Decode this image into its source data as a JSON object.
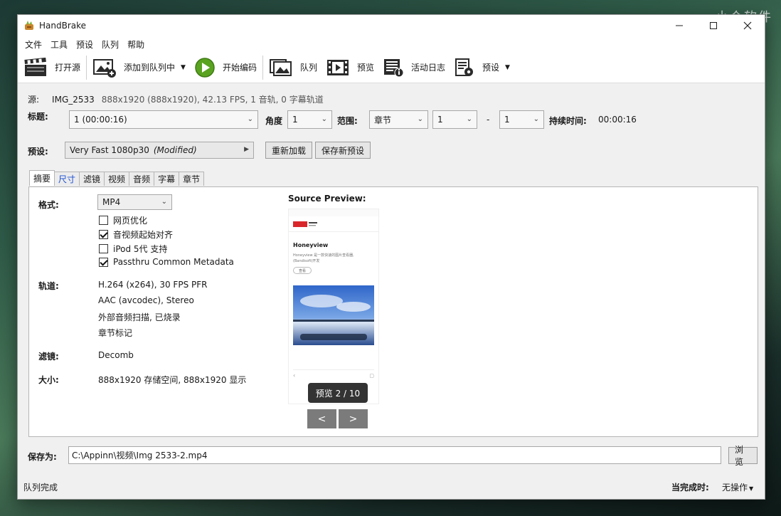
{
  "watermark": "小众软件",
  "window": {
    "title": "HandBrake"
  },
  "menu": [
    "文件",
    "工具",
    "预设",
    "队列",
    "帮助"
  ],
  "toolbar": {
    "open_source": "打开源",
    "add_to_queue": "添加到队列中",
    "start_encode": "开始编码",
    "queue": "队列",
    "preview": "预览",
    "activity_log": "活动日志",
    "presets": "预设"
  },
  "source": {
    "label": "源:",
    "name": "IMG_2533",
    "info": "888x1920 (888x1920), 42.13 FPS, 1 音轨, 0 字幕轨道"
  },
  "title_row": {
    "title_label": "标题:",
    "title_value": "1  (00:00:16)",
    "angle_label": "角度",
    "angle_value": "1",
    "range_label": "范围:",
    "range_type": "章节",
    "range_start": "1",
    "range_dash": "-",
    "range_end": "1",
    "duration_label": "持续时间:",
    "duration_value": "00:00:16"
  },
  "preset_row": {
    "label": "预设:",
    "value": "Very Fast 1080p30",
    "modified": "(Modified)",
    "reload": "重新加载",
    "save_new": "保存新预设"
  },
  "tabs": [
    "摘要",
    "尺寸",
    "滤镜",
    "视频",
    "音频",
    "字幕",
    "章节"
  ],
  "summary": {
    "format_label": "格式:",
    "format_value": "MP4",
    "options": [
      {
        "label": "网页优化",
        "checked": false
      },
      {
        "label": "音视频起始对齐",
        "checked": true
      },
      {
        "label": "iPod 5代 支持",
        "checked": false
      },
      {
        "label": "Passthru Common Metadata",
        "checked": true
      }
    ],
    "tracks_label": "轨道:",
    "tracks": [
      "H.264 (x264), 30 FPS PFR",
      "AAC (avcodec), Stereo",
      "外部音频扫描, 已烧录",
      "章节标记"
    ],
    "filters_label": "滤镜:",
    "filters_value": "Decomb",
    "size_label": "大小:",
    "size_value": "888x1920 存储空间, 888x1920 显示"
  },
  "preview": {
    "title": "Source Preview:",
    "page_heading": "Honeyview",
    "page_text_1": "Honeyview 是一款快速的图片查看器,",
    "page_text_2": "(Bandisoft)开发",
    "page_button": "查看",
    "badge": "预览 2 / 10",
    "prev": "<",
    "next": ">"
  },
  "save": {
    "label": "保存为:",
    "path": "C:\\Appinn\\视频\\Img 2533-2.mp4",
    "browse": "浏览"
  },
  "status": {
    "text": "队列完成",
    "when_done_label": "当完成时:",
    "when_done_value": "无操作"
  }
}
